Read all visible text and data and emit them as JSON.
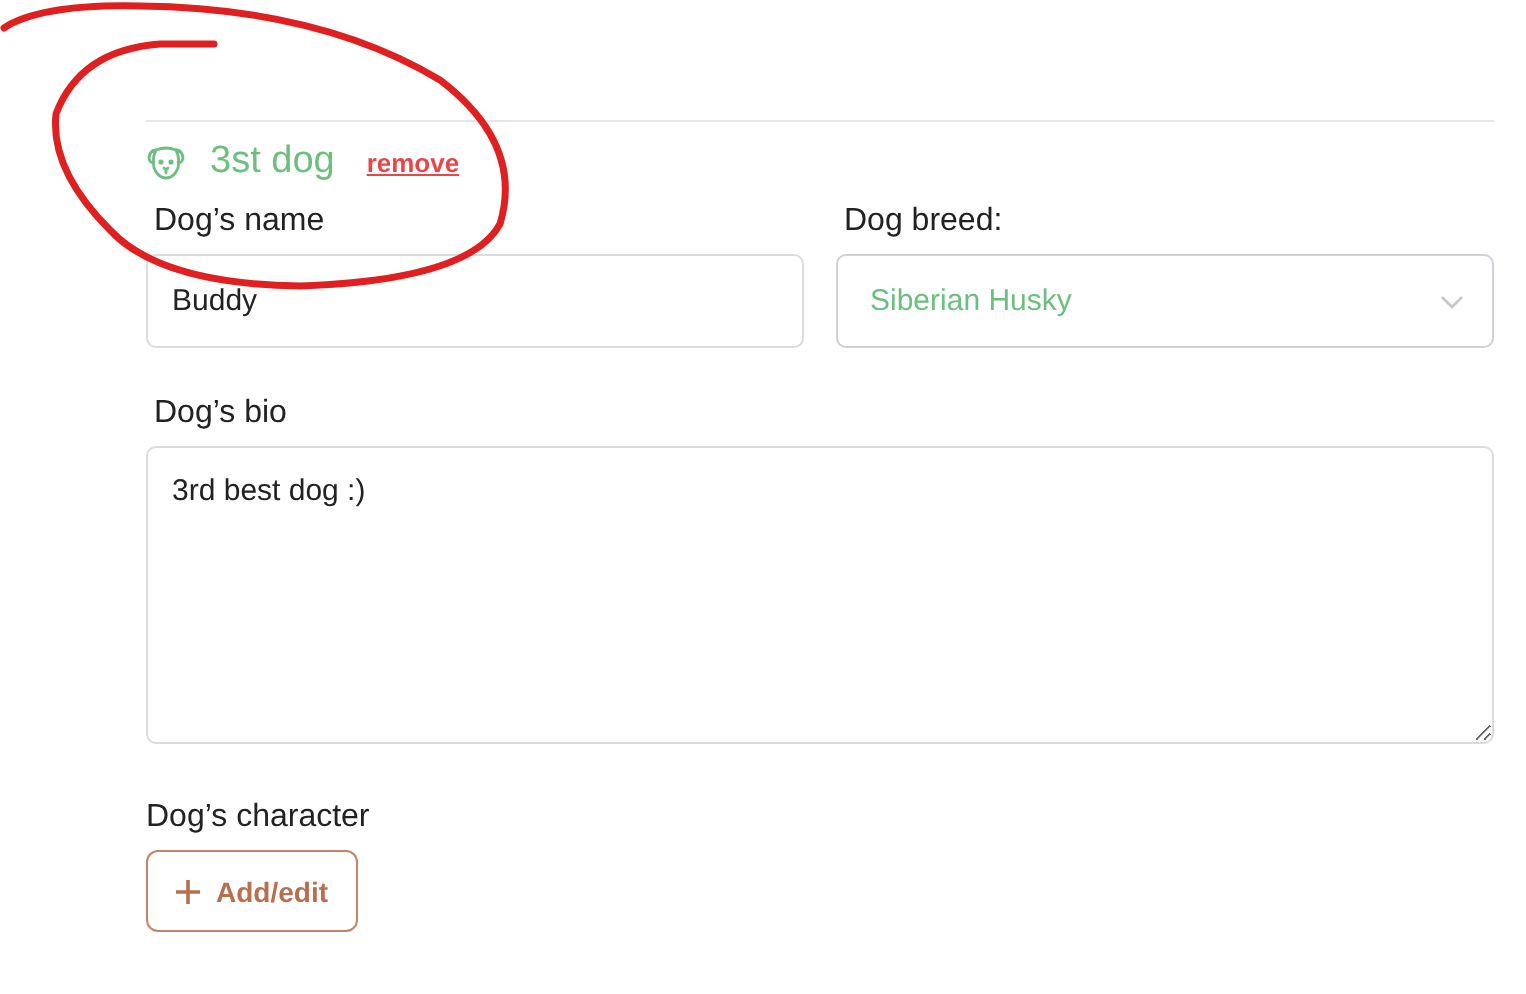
{
  "dog": {
    "title": "3st dog",
    "remove_link": "remove"
  },
  "fields": [
    {
      "kind": "text",
      "label": "Dog’s name",
      "value": "Buddy"
    },
    {
      "kind": "select",
      "label": "Dog breed:",
      "value": "Siberian Husky"
    },
    {
      "kind": "textarea",
      "label": "Dog’s bio",
      "value": "3rd best dog :)"
    }
  ],
  "character": {
    "label": "Dog’s character",
    "button": "Add/edit"
  }
}
